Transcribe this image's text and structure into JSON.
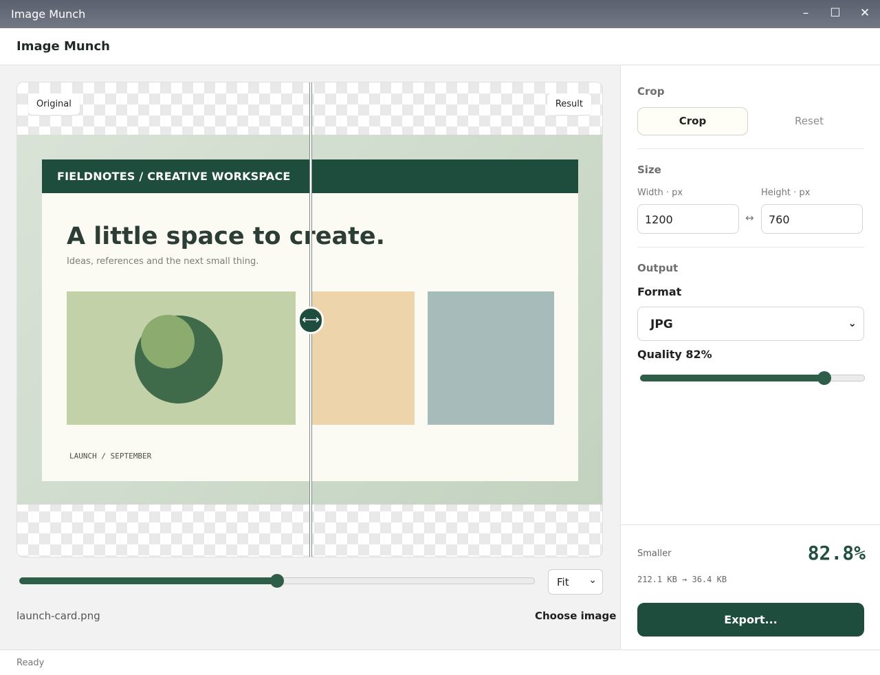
{
  "window": {
    "title": "Image Munch",
    "minimize": "–",
    "maximize": "☐",
    "close": "✕"
  },
  "app_header": {
    "title": "Image Munch"
  },
  "preview": {
    "original_label": "Original",
    "result_label": "Result",
    "compare_handle": "⟷",
    "image": {
      "header": "FIELDNOTES / CREATIVE WORKSPACE",
      "headline": "A little space to create.",
      "subline": "Ideas, references and the next small thing.",
      "footnote": "LAUNCH / SEPTEMBER"
    }
  },
  "zoom": {
    "value_fraction": 0.5,
    "fit_label": "Fit",
    "chevron": "⌄"
  },
  "file": {
    "name": "launch-card.png",
    "choose_label": "Choose image"
  },
  "crop": {
    "section": "Crop",
    "crop_label": "Crop",
    "reset_label": "Reset"
  },
  "size": {
    "section": "Size",
    "width_label": "Width · px",
    "height_label": "Height · px",
    "width": "1200",
    "height": "760",
    "link_icon": "↔"
  },
  "output": {
    "section": "Output",
    "format_label": "Format",
    "format": "JPG",
    "chevron": "⌄",
    "quality_label": "Quality 82%",
    "quality": 0.82
  },
  "savings": {
    "label": "Smaller",
    "percent": "82.8%",
    "sizes": "212.1 KB → 36.4 KB",
    "export_label": "Export..."
  },
  "status": {
    "text": "Ready"
  },
  "colors": {
    "accent": "#1f4d3d",
    "slider": "#2e5e48"
  }
}
